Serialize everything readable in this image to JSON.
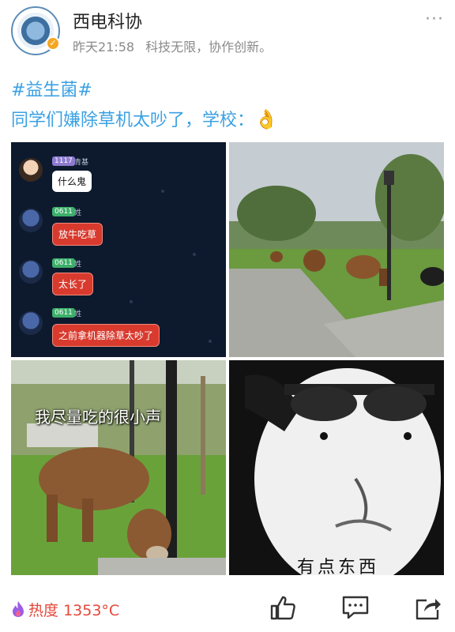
{
  "post": {
    "username": "西电科协",
    "time": "昨天21:58",
    "bio": "科技无限，协作创新。",
    "hashtag": "#益生菌#",
    "text": "同学们嫌除草机太吵了，学校："
  },
  "images": {
    "chat": {
      "messages": [
        {
          "tag": "1117",
          "nick": "青基",
          "text": "什么鬼"
        },
        {
          "tag": "0611",
          "nick": "姓",
          "text": "放牛吃草"
        },
        {
          "tag": "0611",
          "nick": "姓",
          "text": "太长了"
        },
        {
          "tag": "0611",
          "nick": "姓",
          "text": "之前拿机器除草太吵了"
        }
      ]
    },
    "cow_caption": "我尽量吃的很小声",
    "meme_caption": "有点东西"
  },
  "footer": {
    "heat_label": "热度",
    "heat_value": "1353°C"
  },
  "colors": {
    "link_blue": "#3ba1e3",
    "heat_red": "#e5473a",
    "meta_gray": "#8a8a8a"
  }
}
